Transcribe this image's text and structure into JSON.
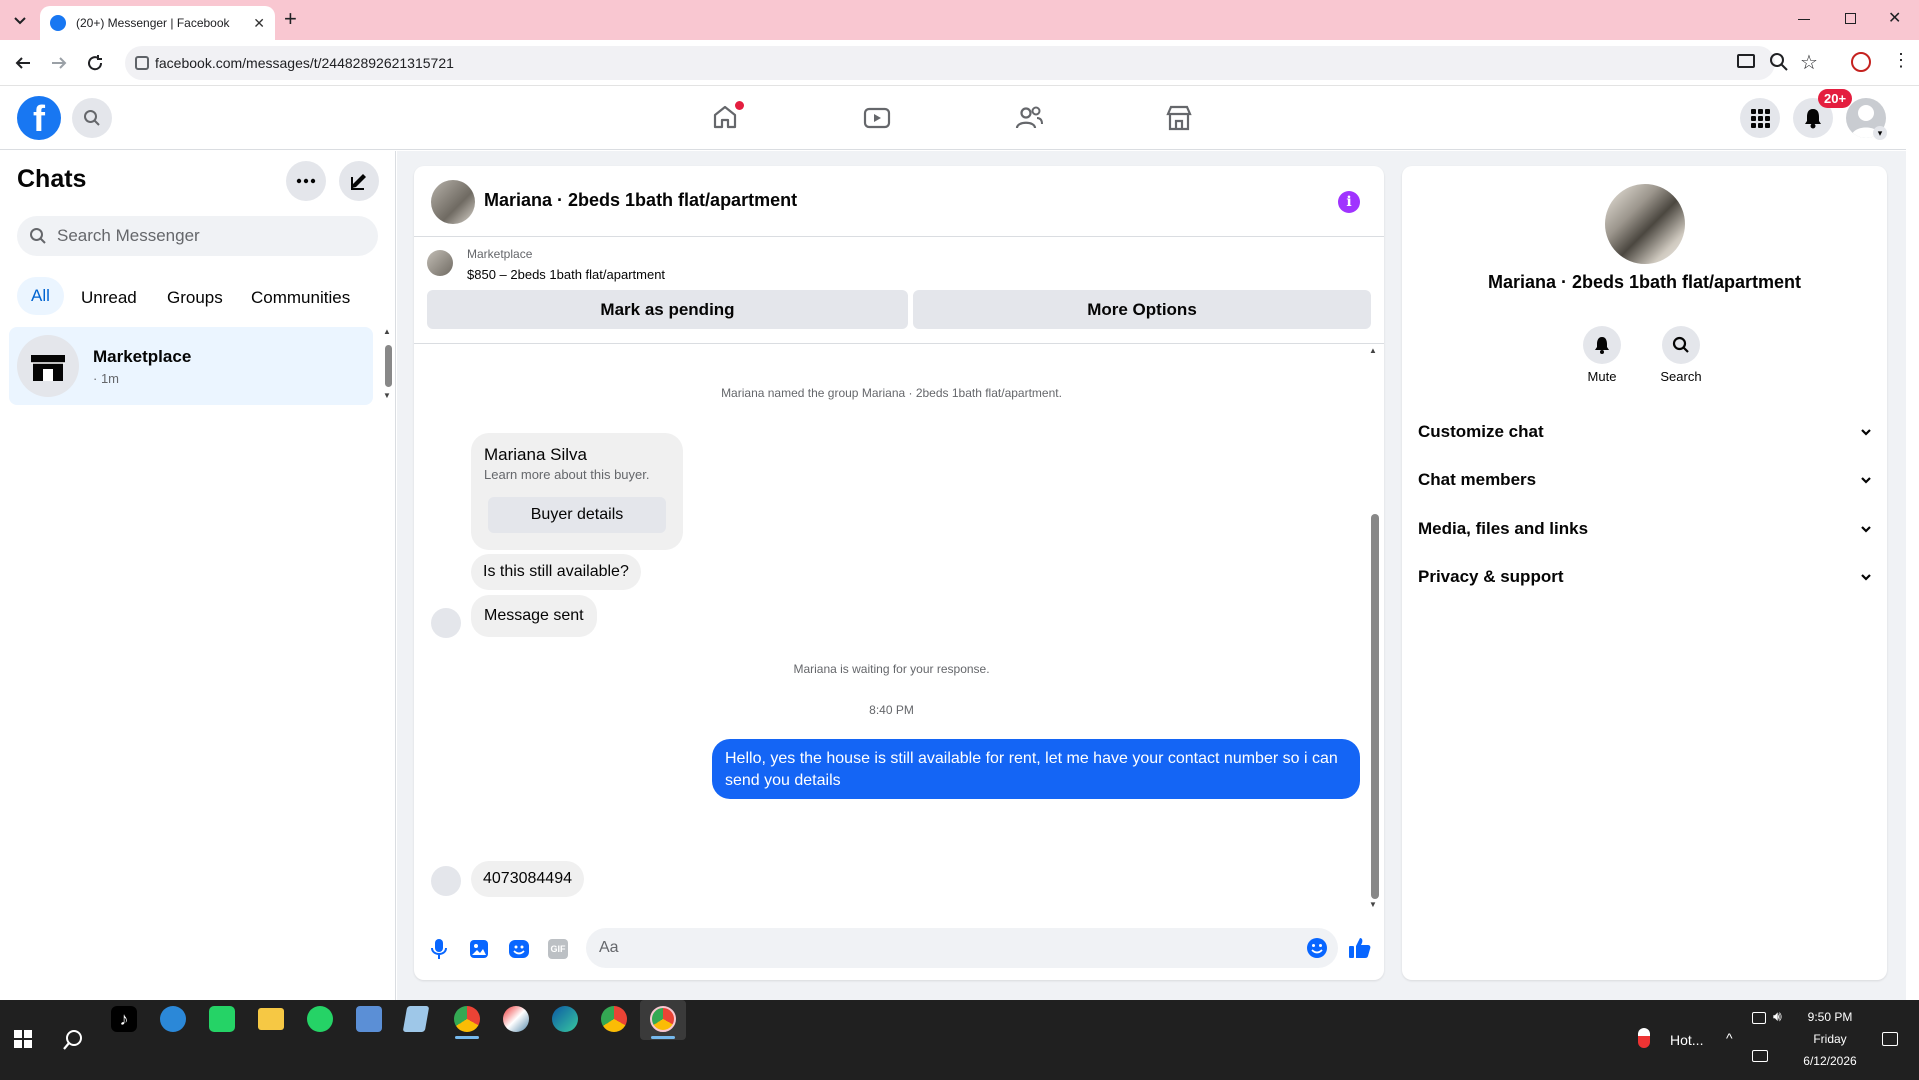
{
  "browser": {
    "tab_title": "(20+) Messenger | Facebook",
    "url": "facebook.com/messages/t/24482892621315721",
    "tab_close": "✕",
    "new_tab": "+",
    "accent": "#f9c7d1"
  },
  "header": {
    "notif_badge": "20+",
    "brand_color": "#1877f2"
  },
  "sidebar": {
    "title": "Chats",
    "search_placeholder": "Search Messenger",
    "filters": [
      "All",
      "Unread",
      "Groups",
      "Communities"
    ],
    "active_filter": "All",
    "chats": [
      {
        "name": "Marketplace",
        "meta": "· 1m"
      }
    ]
  },
  "conversation": {
    "title": "Mariana · 2beds 1bath flat/apartment",
    "listing_source": "Marketplace",
    "listing": "$850 – 2beds 1bath flat/apartment",
    "mark_pending": "Mark as pending",
    "more_options": "More Options",
    "system_named": "Mariana named the group Mariana · 2beds 1bath flat/apartment.",
    "buyer_name": "Mariana Silva",
    "buyer_sub": "Learn more about this buyer.",
    "buyer_details": "Buyer details",
    "msg_available": "Is this still available?",
    "msg_sent": "Message sent",
    "system_waiting": "Mariana is waiting for your response.",
    "time": "8:40 PM",
    "my_message": "Hello, yes the house is still available for rent, let me have your contact number so i can send you details",
    "reply": "4073084494",
    "composer_placeholder": "Aa",
    "gif_label": "GIF"
  },
  "info_panel": {
    "title": "Mariana · 2beds 1bath flat/apartment",
    "mute": "Mute",
    "search": "Search",
    "sections": [
      "Customize chat",
      "Chat members",
      "Media, files and links",
      "Privacy & support"
    ]
  },
  "taskbar": {
    "weather": "Hot...",
    "time": "9:50 PM",
    "day": "Friday",
    "date": "6/12/2026"
  }
}
